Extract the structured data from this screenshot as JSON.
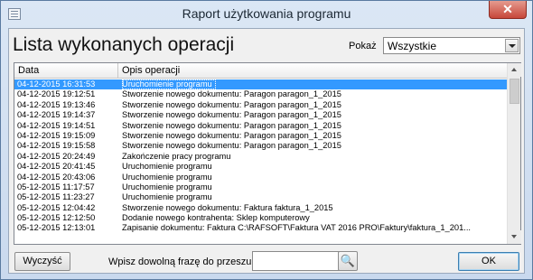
{
  "window": {
    "title": "Raport użytkowania programu",
    "close_glyph": "✕"
  },
  "heading": "Lista wykonanych operacji",
  "filter": {
    "label": "Pokaż",
    "value": "Wszystkie"
  },
  "grid": {
    "columns": [
      "Data",
      "Opis operacji"
    ],
    "rows": [
      {
        "date": "04-12-2015 16:31:53",
        "desc": "Uruchomienie programu",
        "selected": true
      },
      {
        "date": "04-12-2015 19:12:51",
        "desc": "Stworzenie nowego dokumentu: Paragon paragon_1_2015"
      },
      {
        "date": "04-12-2015 19:13:46",
        "desc": "Stworzenie nowego dokumentu: Paragon paragon_1_2015"
      },
      {
        "date": "04-12-2015 19:14:37",
        "desc": "Stworzenie nowego dokumentu: Paragon paragon_1_2015"
      },
      {
        "date": "04-12-2015 19:14:51",
        "desc": "Stworzenie nowego dokumentu: Paragon paragon_1_2015"
      },
      {
        "date": "04-12-2015 19:15:09",
        "desc": "Stworzenie nowego dokumentu: Paragon paragon_1_2015"
      },
      {
        "date": "04-12-2015 19:15:58",
        "desc": "Stworzenie nowego dokumentu: Paragon paragon_1_2015"
      },
      {
        "date": "04-12-2015 20:24:49",
        "desc": "Zakończenie pracy programu"
      },
      {
        "date": "04-12-2015 20:41:45",
        "desc": "Uruchomienie programu"
      },
      {
        "date": "04-12-2015 20:43:06",
        "desc": "Uruchomienie programu"
      },
      {
        "date": "05-12-2015 11:17:57",
        "desc": "Uruchomienie programu"
      },
      {
        "date": "05-12-2015 11:23:27",
        "desc": "Uruchomienie programu"
      },
      {
        "date": "05-12-2015 12:04:42",
        "desc": "Stworzenie nowego dokumentu: Faktura faktura_1_2015"
      },
      {
        "date": "05-12-2015 12:12:50",
        "desc": "Dodanie nowego kontrahenta: Sklep komputerowy"
      },
      {
        "date": "05-12-2015 12:13:01",
        "desc": "Zapisanie dokumentu: Faktura C:\\RAFSOFT\\Faktura VAT 2016 PRO\\Faktury\\faktura_1_201..."
      }
    ]
  },
  "footer": {
    "clear_label": "Wyczyść",
    "search_label": "Wpisz dowolną frazę do przeszukania",
    "search_value": "",
    "find_glyph": "🔍",
    "ok_label": "OK"
  },
  "colors": {
    "selection": "#3399ff",
    "close": "#c7473a"
  }
}
